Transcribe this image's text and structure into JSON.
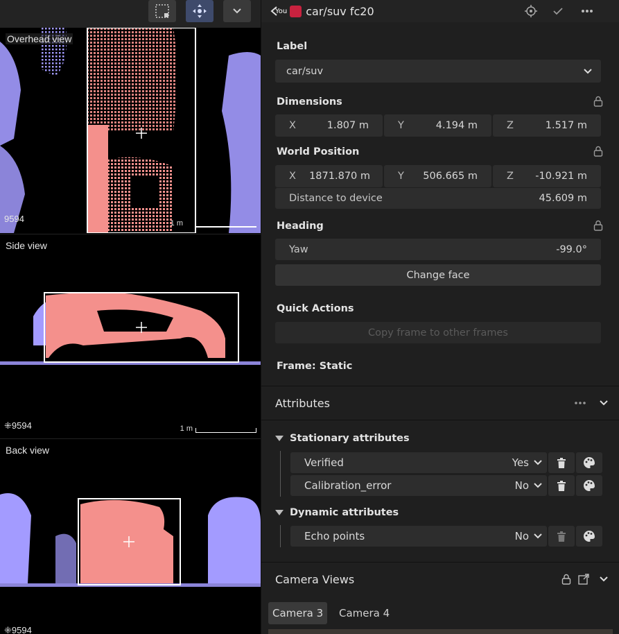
{
  "views": {
    "overhead": {
      "title": "Overhead view",
      "points": "9594",
      "scale": "1 m"
    },
    "side": {
      "title": "Side view",
      "points": "9594",
      "scale": "1 m"
    },
    "back": {
      "title": "Back view",
      "points": "9594"
    }
  },
  "header": {
    "you_badge": "You",
    "title": "car/suv fc20",
    "accent": "#c8223f"
  },
  "label": {
    "heading": "Label",
    "value": "car/suv"
  },
  "dimensions": {
    "heading": "Dimensions",
    "x_axis": "X",
    "x": "1.807 m",
    "y_axis": "Y",
    "y": "4.194 m",
    "z_axis": "Z",
    "z": "1.517 m"
  },
  "world_position": {
    "heading": "World Position",
    "x_axis": "X",
    "x": "1871.870 m",
    "y_axis": "Y",
    "y": "506.665 m",
    "z_axis": "Z",
    "z": "-10.921 m",
    "distance_label": "Distance to device",
    "distance": "45.609 m"
  },
  "heading": {
    "heading": "Heading",
    "yaw_label": "Yaw",
    "yaw": "-99.0°",
    "change_face": "Change face"
  },
  "quick_actions": {
    "heading": "Quick Actions",
    "copy_frame": "Copy frame to other frames"
  },
  "frame": {
    "label": "Frame: Static"
  },
  "attributes": {
    "heading": "Attributes",
    "stationary": {
      "heading": "Stationary attributes",
      "items": [
        {
          "name": "Verified",
          "value": "Yes"
        },
        {
          "name": "Calibration_error",
          "value": "No"
        }
      ]
    },
    "dynamic": {
      "heading": "Dynamic attributes",
      "items": [
        {
          "name": "Echo points",
          "value": "No"
        }
      ]
    }
  },
  "camera_views": {
    "heading": "Camera Views",
    "tabs": [
      "Camera 3",
      "Camera 4"
    ]
  },
  "colors": {
    "cloud": "#a39bff",
    "selected": "#f4908c",
    "panel": "#1f1f1f",
    "field": "#2d2d2d"
  }
}
